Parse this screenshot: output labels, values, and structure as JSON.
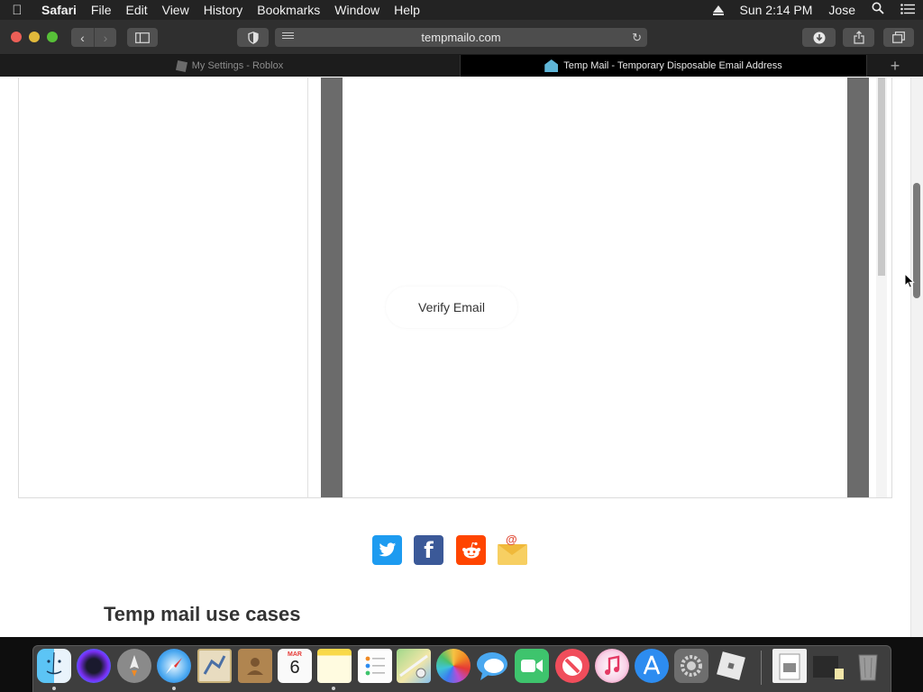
{
  "menubar": {
    "app_name": "Safari",
    "menus": [
      "File",
      "Edit",
      "View",
      "History",
      "Bookmarks",
      "Window",
      "Help"
    ],
    "clock": "Sun 2:14 PM",
    "user": "Jose"
  },
  "toolbar": {
    "url": "tempmailo.com"
  },
  "tabs": [
    {
      "title": "My Settings - Roblox"
    },
    {
      "title": "Temp Mail - Temporary Disposable Email Address"
    }
  ],
  "page": {
    "verify_button": "Verify Email",
    "section_heading": "Temp mail use cases",
    "share_icons": [
      "twitter-icon",
      "facebook-icon",
      "reddit-icon",
      "email-icon"
    ],
    "colors": {
      "twitter": "#1d9bf0",
      "facebook": "#3b5998",
      "reddit": "#ff4500",
      "email": "#f7cf62"
    }
  },
  "dock": {
    "apps": [
      "Finder",
      "Siri",
      "Launchpad",
      "Safari",
      "Mail",
      "Contacts",
      "Calendar",
      "Notes",
      "Reminders",
      "Maps",
      "Photos",
      "Messages",
      "FaceTime",
      "News",
      "Music",
      "App Store",
      "System Preferences",
      "Roblox",
      "Preview",
      "Files",
      "Trash"
    ],
    "calendar_month": "MAR",
    "calendar_day": "6"
  }
}
